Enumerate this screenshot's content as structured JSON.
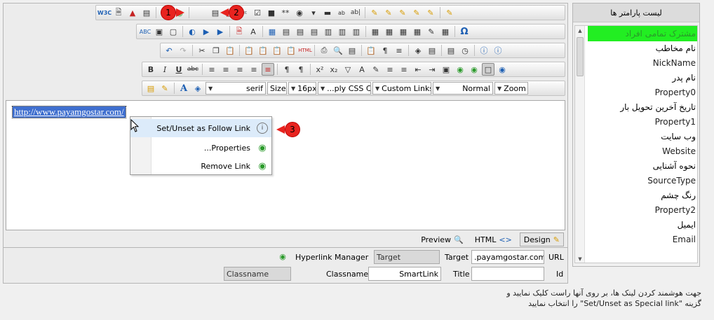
{
  "toolbar1": {
    "icons": [
      "w3c-validator",
      "new-doc",
      "spell",
      "template",
      "image-manager",
      "hyperlink-manager",
      "list-box",
      "select-all",
      "form-dropdown",
      "textbox",
      "checkbox",
      "select",
      "hidden-field",
      "radio",
      "dropdown",
      "button",
      "textarea",
      "label",
      "pen-1",
      "pen-2",
      "pen-3",
      "pen-4",
      "pen-5"
    ],
    "w3c_label": "W3C"
  },
  "toolbar3": {
    "omega": "Ω"
  },
  "toolbar5": {
    "font_name": "serif",
    "font_size_label": "Size",
    "font_px": "16px",
    "css_class": "...ply CSS Class",
    "custom_links": "Custom Links",
    "paragraph": "Normal",
    "zoom": "Zoom"
  },
  "content": {
    "link_text": "http://www.payamgostar.com/"
  },
  "context_menu": {
    "items": [
      {
        "label": "Set/Unset as Follow Link",
        "icon": "info-icon"
      },
      {
        "label": "...Properties",
        "icon": "link-globe-icon"
      },
      {
        "label": "Remove Link",
        "icon": "link-globe-icon"
      }
    ]
  },
  "markers": {
    "m1": "1",
    "m2": "2",
    "m3": "3"
  },
  "modes": {
    "preview": "Preview",
    "html": "HTML",
    "design": "Design"
  },
  "hyperlink_manager": {
    "title": "Hyperlink Manager",
    "url_label": "URL",
    "url_value": ".payamgostar.com",
    "target_label": "Target",
    "target_value": "",
    "target_dropdown": "Target",
    "id_label": "Id",
    "title_label": "Title",
    "title_value": "SmartLink",
    "classname_label": "Classname",
    "classname_value": "",
    "classname_dropdown": "Classname"
  },
  "panel": {
    "title": "لیست پارامتر ها",
    "items": [
      {
        "fa": "مشترک تمامی افراد",
        "en": "",
        "highlight": true
      },
      {
        "fa": "نام مخاطب",
        "en": "NickName"
      },
      {
        "fa": "نام پدر",
        "en": "Property0"
      },
      {
        "fa": "تاریخ آخرین تحویل بار",
        "en": "Property1"
      },
      {
        "fa": "وب سایت",
        "en": "Website"
      },
      {
        "fa": "نحوه آشنایی",
        "en": "SourceType"
      },
      {
        "fa": "رنگ چشم",
        "en": "Property2"
      },
      {
        "fa": "ایمیل",
        "en": "Email"
      }
    ]
  },
  "footnote": {
    "line1": "جهت هوشمند کردن لینک ها، بر روی آنها راست کلیک نمایید و",
    "line2": "گزینه \"Set/Unset as Special link\" را انتخاب نمایید"
  }
}
